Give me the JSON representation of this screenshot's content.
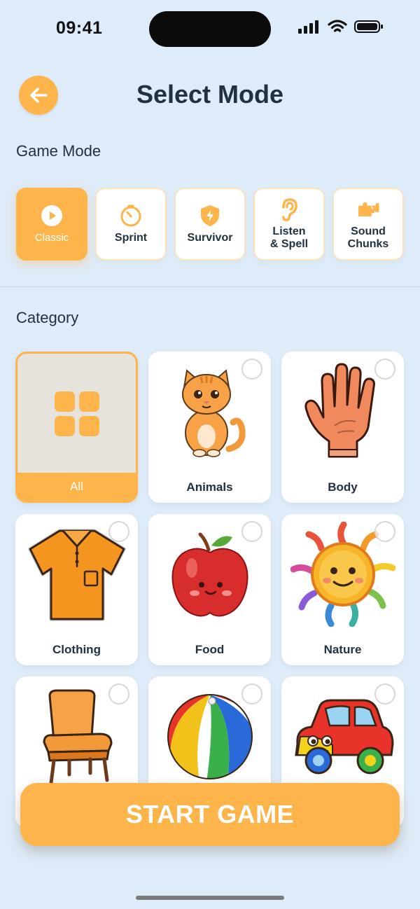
{
  "status_bar": {
    "time": "09:41",
    "icons": [
      "cellular-signal-icon",
      "wifi-icon",
      "battery-icon"
    ]
  },
  "header": {
    "title": "Select Mode",
    "back_icon": "arrow-left-icon"
  },
  "game_mode": {
    "label": "Game Mode",
    "modes": [
      {
        "label": "Classic",
        "icon": "play-circle-icon",
        "selected": true
      },
      {
        "label": "Sprint",
        "icon": "timer-icon",
        "selected": false
      },
      {
        "label": "Survivor",
        "icon": "shield-bolt-icon",
        "selected": false
      },
      {
        "label": "Listen\n& Spell",
        "icon": "ear-icon",
        "selected": false
      },
      {
        "label": "Sound\nChunks",
        "icon": "puzzle-icon",
        "selected": false
      }
    ]
  },
  "category": {
    "label": "Category",
    "items": [
      {
        "label": "All",
        "icon": "grid-icon",
        "selected": true
      },
      {
        "label": "Animals",
        "icon": "cat-illustration",
        "selected": false
      },
      {
        "label": "Body",
        "icon": "hand-illustration",
        "selected": false
      },
      {
        "label": "Clothing",
        "icon": "shirt-illustration",
        "selected": false
      },
      {
        "label": "Food",
        "icon": "apple-illustration",
        "selected": false
      },
      {
        "label": "Nature",
        "icon": "sun-illustration",
        "selected": false
      },
      {
        "label": "",
        "icon": "chair-illustration",
        "selected": false
      },
      {
        "label": "",
        "icon": "beach-ball-illustration",
        "selected": false
      },
      {
        "label": "",
        "icon": "toy-car-illustration",
        "selected": false
      }
    ]
  },
  "start_button": {
    "label": "START GAME"
  },
  "colors": {
    "accent": "#fdb44b",
    "background": "#deebf8",
    "text": "#22313f"
  }
}
